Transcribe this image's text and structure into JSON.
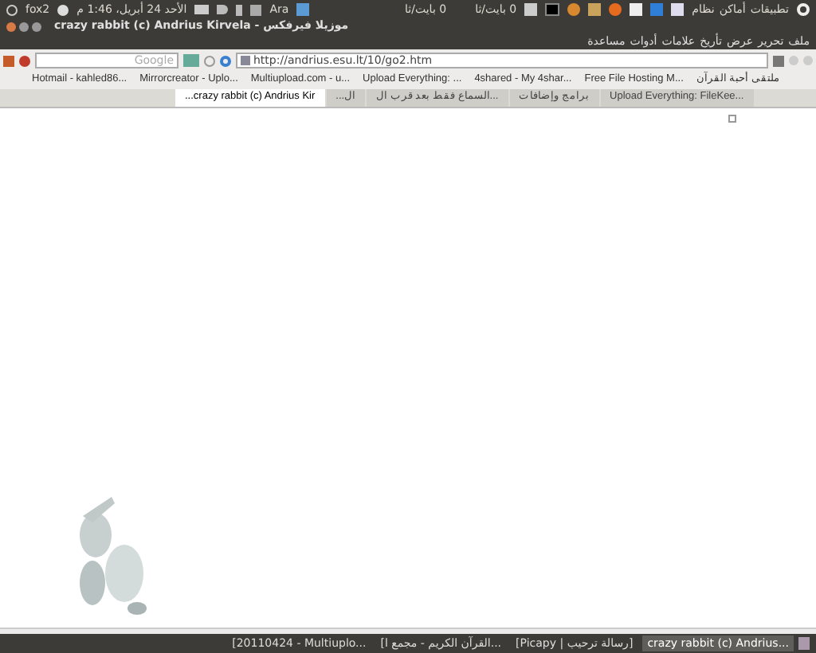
{
  "top_panel": {
    "user": "fox2",
    "clock": "الأحد 24 أبريل، 1:46 م",
    "keyboard": "Ara",
    "net_speeds": [
      "0 بايت/ثا",
      "0 بايت/ثا"
    ],
    "menus": [
      "تطبيقات",
      "أماكن",
      "نظام"
    ]
  },
  "window": {
    "title": "موزيلا فيرفكس - crazy rabbit (c) Andrius Kirvela"
  },
  "menu_bar": [
    "ملف",
    "تحرير",
    "عرض",
    "تأريخ",
    "علامات",
    "أدوات",
    "مساعدة"
  ],
  "toolbar": {
    "search": {
      "placeholder": "Google"
    },
    "url": "http://andrius.esu.lt/10/go2.htm"
  },
  "bookmarks": [
    "ملتقى أحبة القرآن",
    "Free File Hosting M...",
    "4shared - My 4shar...",
    "Upload Everything: ...",
    "Multiupload.com - u...",
    "Mirrorcreator - Uplo...",
    "Hotmail - kahled86..."
  ],
  "tabs": [
    {
      "label": "Upload Everything: FileKee...",
      "selected": false
    },
    {
      "label": "برامج وإضافات",
      "selected": false
    },
    {
      "label": "السماع فقط بعد قرب ال...",
      "selected": false
    },
    {
      "label": "...ال",
      "selected": false
    },
    {
      "label": "...crazy rabbit (c) Andrius Kir",
      "selected": true
    }
  ],
  "taskbar": [
    {
      "label": "crazy rabbit (c) Andrius...",
      "selected": true
    },
    {
      "label": "[Picapy | رسالة ترحيب]",
      "selected": false
    },
    {
      "label": "[القرآن الكريم - مجمع ا...",
      "selected": false
    },
    {
      "label": "[20110424 - Multiuplo...",
      "selected": false
    }
  ]
}
